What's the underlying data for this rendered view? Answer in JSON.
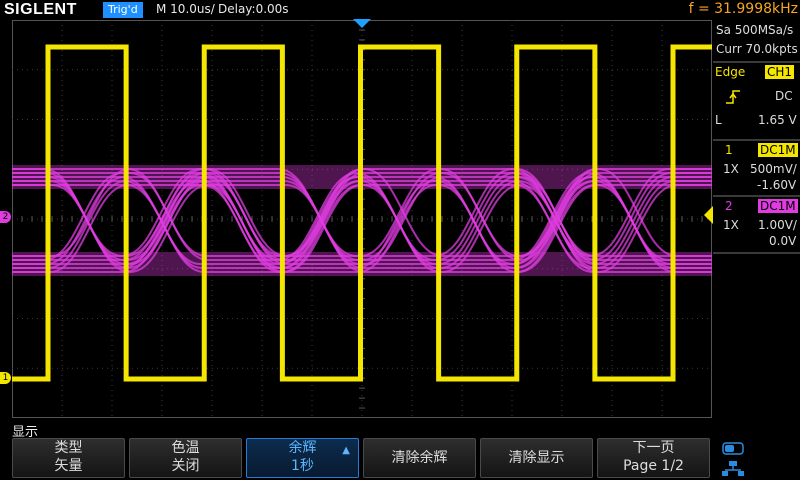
{
  "topbar": {
    "logo": "SIGLENT",
    "trigger_status": "Trig'd",
    "timebase": "M 10.0us/",
    "delay": "Delay:0.00s",
    "frequency": "f = 31.9998kHz"
  },
  "acquisition": {
    "sample_rate": "Sa 500MSa/s",
    "memory_depth": "Curr 70.0kpts"
  },
  "trigger": {
    "type": "Edge",
    "source": "CH1",
    "coupling": "DC",
    "level_label": "L",
    "level": "1.65 V"
  },
  "channels": [
    {
      "index": "1",
      "coupling": "DC1M",
      "probe": "1X",
      "scale": "500mV/",
      "offset": "-1.60V",
      "color": "#f5e600"
    },
    {
      "index": "2",
      "coupling": "DC1M",
      "probe": "1X",
      "scale": "1.00V/",
      "offset": "0.0V",
      "color": "#e03ce0"
    }
  ],
  "markers": {
    "ch1": "1",
    "ch2": "2"
  },
  "menu": {
    "title": "显示",
    "softkeys": [
      {
        "l1": "类型",
        "l2": "矢量"
      },
      {
        "l1": "色温",
        "l2": "关闭"
      },
      {
        "l1": "余辉",
        "l2": "1秒"
      },
      {
        "label": "清除余辉"
      },
      {
        "label": "清除显示"
      },
      {
        "l1": "下一页",
        "l2": "Page 1/2"
      }
    ]
  },
  "colors": {
    "ch1": "#f5e600",
    "ch2": "#e03ce0",
    "accent": "#1e90ff",
    "frequency": "#f5a623"
  }
}
